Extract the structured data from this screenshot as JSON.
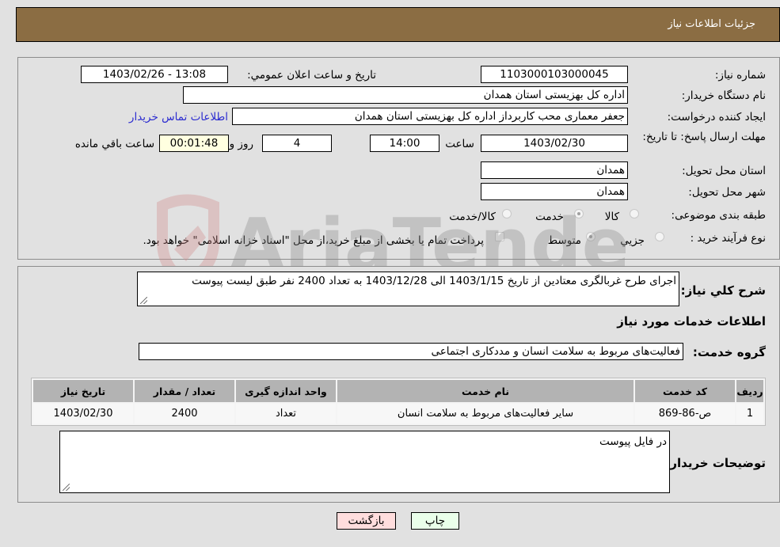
{
  "header": {
    "title": "جزئیات اطلاعات نیاز"
  },
  "fields": {
    "need_number": {
      "label": "شماره نیاز:",
      "value": "1103000103000045"
    },
    "announce_datetime": {
      "label": "تاریخ و ساعت اعلان عمومي:",
      "value": "1403/02/26 - 13:08"
    },
    "buyer_org": {
      "label": "نام دستگاه خریدار:",
      "value": "اداره کل بهزیستی استان همدان"
    },
    "requester": {
      "label": "ایجاد کننده درخواست:",
      "value": "جعفر معماری محب کاربرداز اداره کل بهزیستی استان همدان"
    },
    "buyer_contact_link": "اطلاعات تماس خریدار",
    "deadline": {
      "label": "مهلت ارسال پاسخ: تا تاریخ:",
      "date": "1403/02/30",
      "time_label": "ساعت",
      "time": "14:00",
      "days": "4",
      "days_label": "روز و",
      "remaining": "00:01:48",
      "remaining_label": "ساعت باقي مانده"
    },
    "delivery_province": {
      "label": "استان محل تحویل:",
      "value": "همدان"
    },
    "delivery_city": {
      "label": "شهر محل تحویل:",
      "value": "همدان"
    },
    "category": {
      "label": "طبقه بندی موضوعی:",
      "options": [
        {
          "label": "کالا",
          "checked": false
        },
        {
          "label": "خدمت",
          "checked": true
        },
        {
          "label": "کالا/خدمت",
          "checked": false
        }
      ]
    },
    "purchase_type": {
      "label": "نوع فرآیند خرید :",
      "options": [
        {
          "label": "جزيي",
          "checked": false
        },
        {
          "label": "متوسط",
          "checked": true
        }
      ],
      "treasury_note": "پرداخت تمام یا بخشی از مبلغ خرید،از محل \"اسناد خزانه اسلامی\" خواهد بود."
    }
  },
  "details": {
    "description_label": "شرح كلي نياز:",
    "description": "اجرای طرح غربالگری معتادین از تاریخ 1403/1/15 الی 1403/12/28 به تعداد 2400 نفر طبق لیست پیوست",
    "services_heading": "اطلاعات خدمات مورد نیاز",
    "service_group_label": "گروه خدمت:",
    "service_group": "فعالیت‌های مربوط به سلامت انسان و مددکاری اجتماعی",
    "table": {
      "headers": [
        "ردیف",
        "کد خدمت",
        "نام خدمت",
        "واحد اندازه گیری",
        "تعداد / مقدار",
        "تاریخ نیاز"
      ],
      "rows": [
        [
          "1",
          "ص-86-869",
          "سایر فعالیت‌های مربوط به سلامت انسان",
          "تعداد",
          "2400",
          "1403/02/30"
        ]
      ]
    },
    "buyer_notes_label": "توضیحات خریدار:",
    "buyer_notes": "در فایل پیوست"
  },
  "buttons": {
    "print": "چاپ",
    "back": "بازگشت"
  },
  "watermark": {
    "text": "AriaTender.neT"
  },
  "colors": {
    "header_bg": "#8b6d43",
    "back_btn": "#ffdddd",
    "print_btn": "#eaffea",
    "link": "#2b2bd0"
  }
}
